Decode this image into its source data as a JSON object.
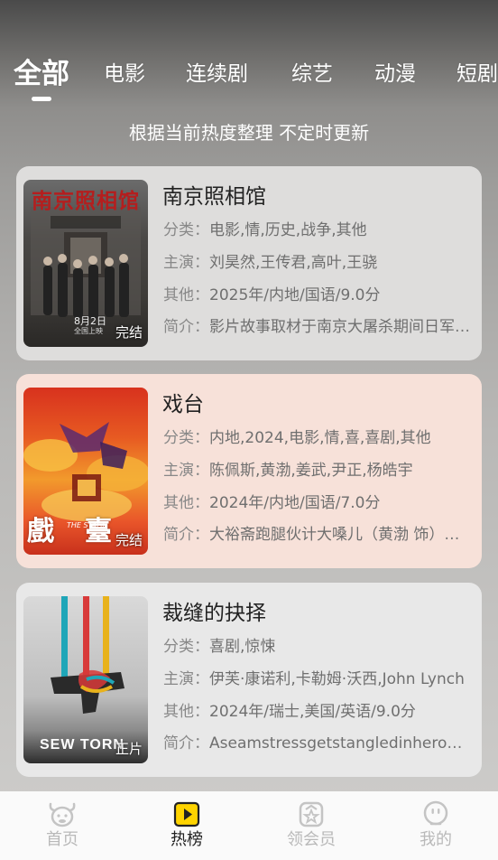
{
  "tabs": [
    {
      "label": "全部",
      "active": true
    },
    {
      "label": "电影"
    },
    {
      "label": "连续剧"
    },
    {
      "label": "综艺"
    },
    {
      "label": "动漫"
    },
    {
      "label": "短剧"
    }
  ],
  "subtitle": "根据当前热度整理 不定时更新",
  "labels": {
    "category": "分类：",
    "cast": "主演：",
    "other": "其他：",
    "intro": "简介："
  },
  "items": [
    {
      "title": "南京照相馆",
      "category": "电影,情,历史,战争,其他",
      "cast": "刘昊然,王传君,高叶,王骁",
      "other": "2025年/内地/国语/9.0分",
      "intro": "影片故事取材于南京大屠杀期间日军暴行的真实照片",
      "status": "完结",
      "poster_title": "南京照相馆",
      "poster_date": "8月2日",
      "poster_sub": "全国上映",
      "card_color": "#dedddc"
    },
    {
      "title": "戏台",
      "category": "内地,2024,电影,情,喜,喜剧,其他",
      "cast": "陈佩斯,黄渤,姜武,尹正,杨皓宇",
      "other": "2024年/内地/国语/7.0分",
      "intro": "大裕斋跑腿伙计大嗓儿（黄渤 饰）阴差阳错",
      "status": "完结",
      "poster_title": "戲臺",
      "poster_sub": "THE STAGE",
      "card_color": "#f7e1d9"
    },
    {
      "title": "裁缝的抉择",
      "category": "喜剧,惊悚",
      "cast": "伊芙·康诺利,卡勒姆·沃西,John Lynch",
      "other": "2024年/瑞士,美国/英语/9.0分",
      "intro": "Aseamstressgetstangledinherownworkwhen",
      "status": "正片",
      "poster_title": "SEW TORN",
      "card_color": "#e8e8e8"
    }
  ],
  "nav": [
    {
      "label": "首页",
      "icon": "cow-face-icon"
    },
    {
      "label": "热榜",
      "icon": "play-box-icon",
      "active": true
    },
    {
      "label": "领会员",
      "icon": "vip-gift-icon"
    },
    {
      "label": "我的",
      "icon": "profile-face-icon"
    }
  ],
  "colors": {
    "accent": "#ffd400",
    "active_text": "#222222",
    "inactive_text": "#b9b9b9"
  }
}
